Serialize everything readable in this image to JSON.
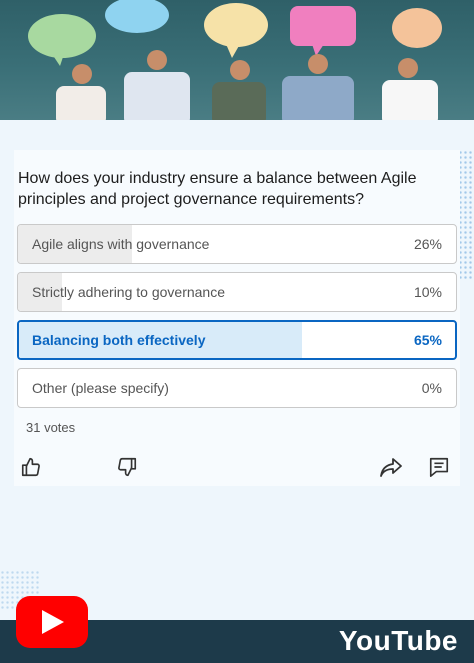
{
  "hero": {
    "icon": "people-with-speech-bubbles-photo"
  },
  "poll": {
    "question": "How does your industry ensure a balance between Agile principles and project governance requirements?",
    "options": [
      {
        "label": "Agile aligns with governance",
        "percent": "26%",
        "value": 26,
        "selected": false
      },
      {
        "label": "Strictly adhering to governance",
        "percent": "10%",
        "value": 10,
        "selected": false
      },
      {
        "label": "Balancing both effectively",
        "percent": "65%",
        "value": 65,
        "selected": true
      },
      {
        "label": "Other (please specify)",
        "percent": "0%",
        "value": 0,
        "selected": false
      }
    ],
    "votes": "31 votes"
  },
  "actions": {
    "like": "thumbs-up-icon",
    "dislike": "thumbs-down-icon",
    "share": "share-arrow-icon",
    "comment": "comment-icon"
  },
  "footer": {
    "brand": "YouTube"
  },
  "colors": {
    "accent": "#0a66c2",
    "selected_fill": "#d8ebf9",
    "youtube_red": "#ff0000",
    "footer_bg": "#1d3a4a"
  }
}
